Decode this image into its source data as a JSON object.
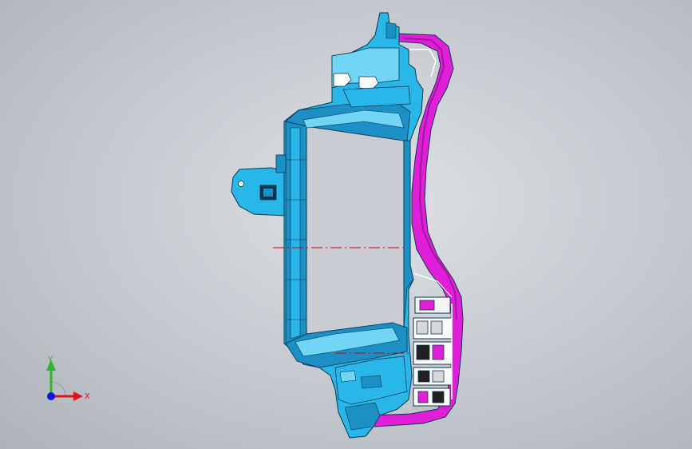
{
  "viewport": {
    "background": "#c8ccd2",
    "colors": {
      "frame": "#29b6e8",
      "frame_dark": "#1c8fc4",
      "frame_light": "#73d5f5",
      "housing": "#e020d8",
      "housing_dark": "#a514a0",
      "edge": "#0a3550",
      "centerline": "#d00000"
    }
  },
  "triad": {
    "x_label": "X",
    "y_label": "Y",
    "x_color": "#e0141e",
    "y_color": "#2fb52f",
    "z_color": "#1414e0"
  }
}
